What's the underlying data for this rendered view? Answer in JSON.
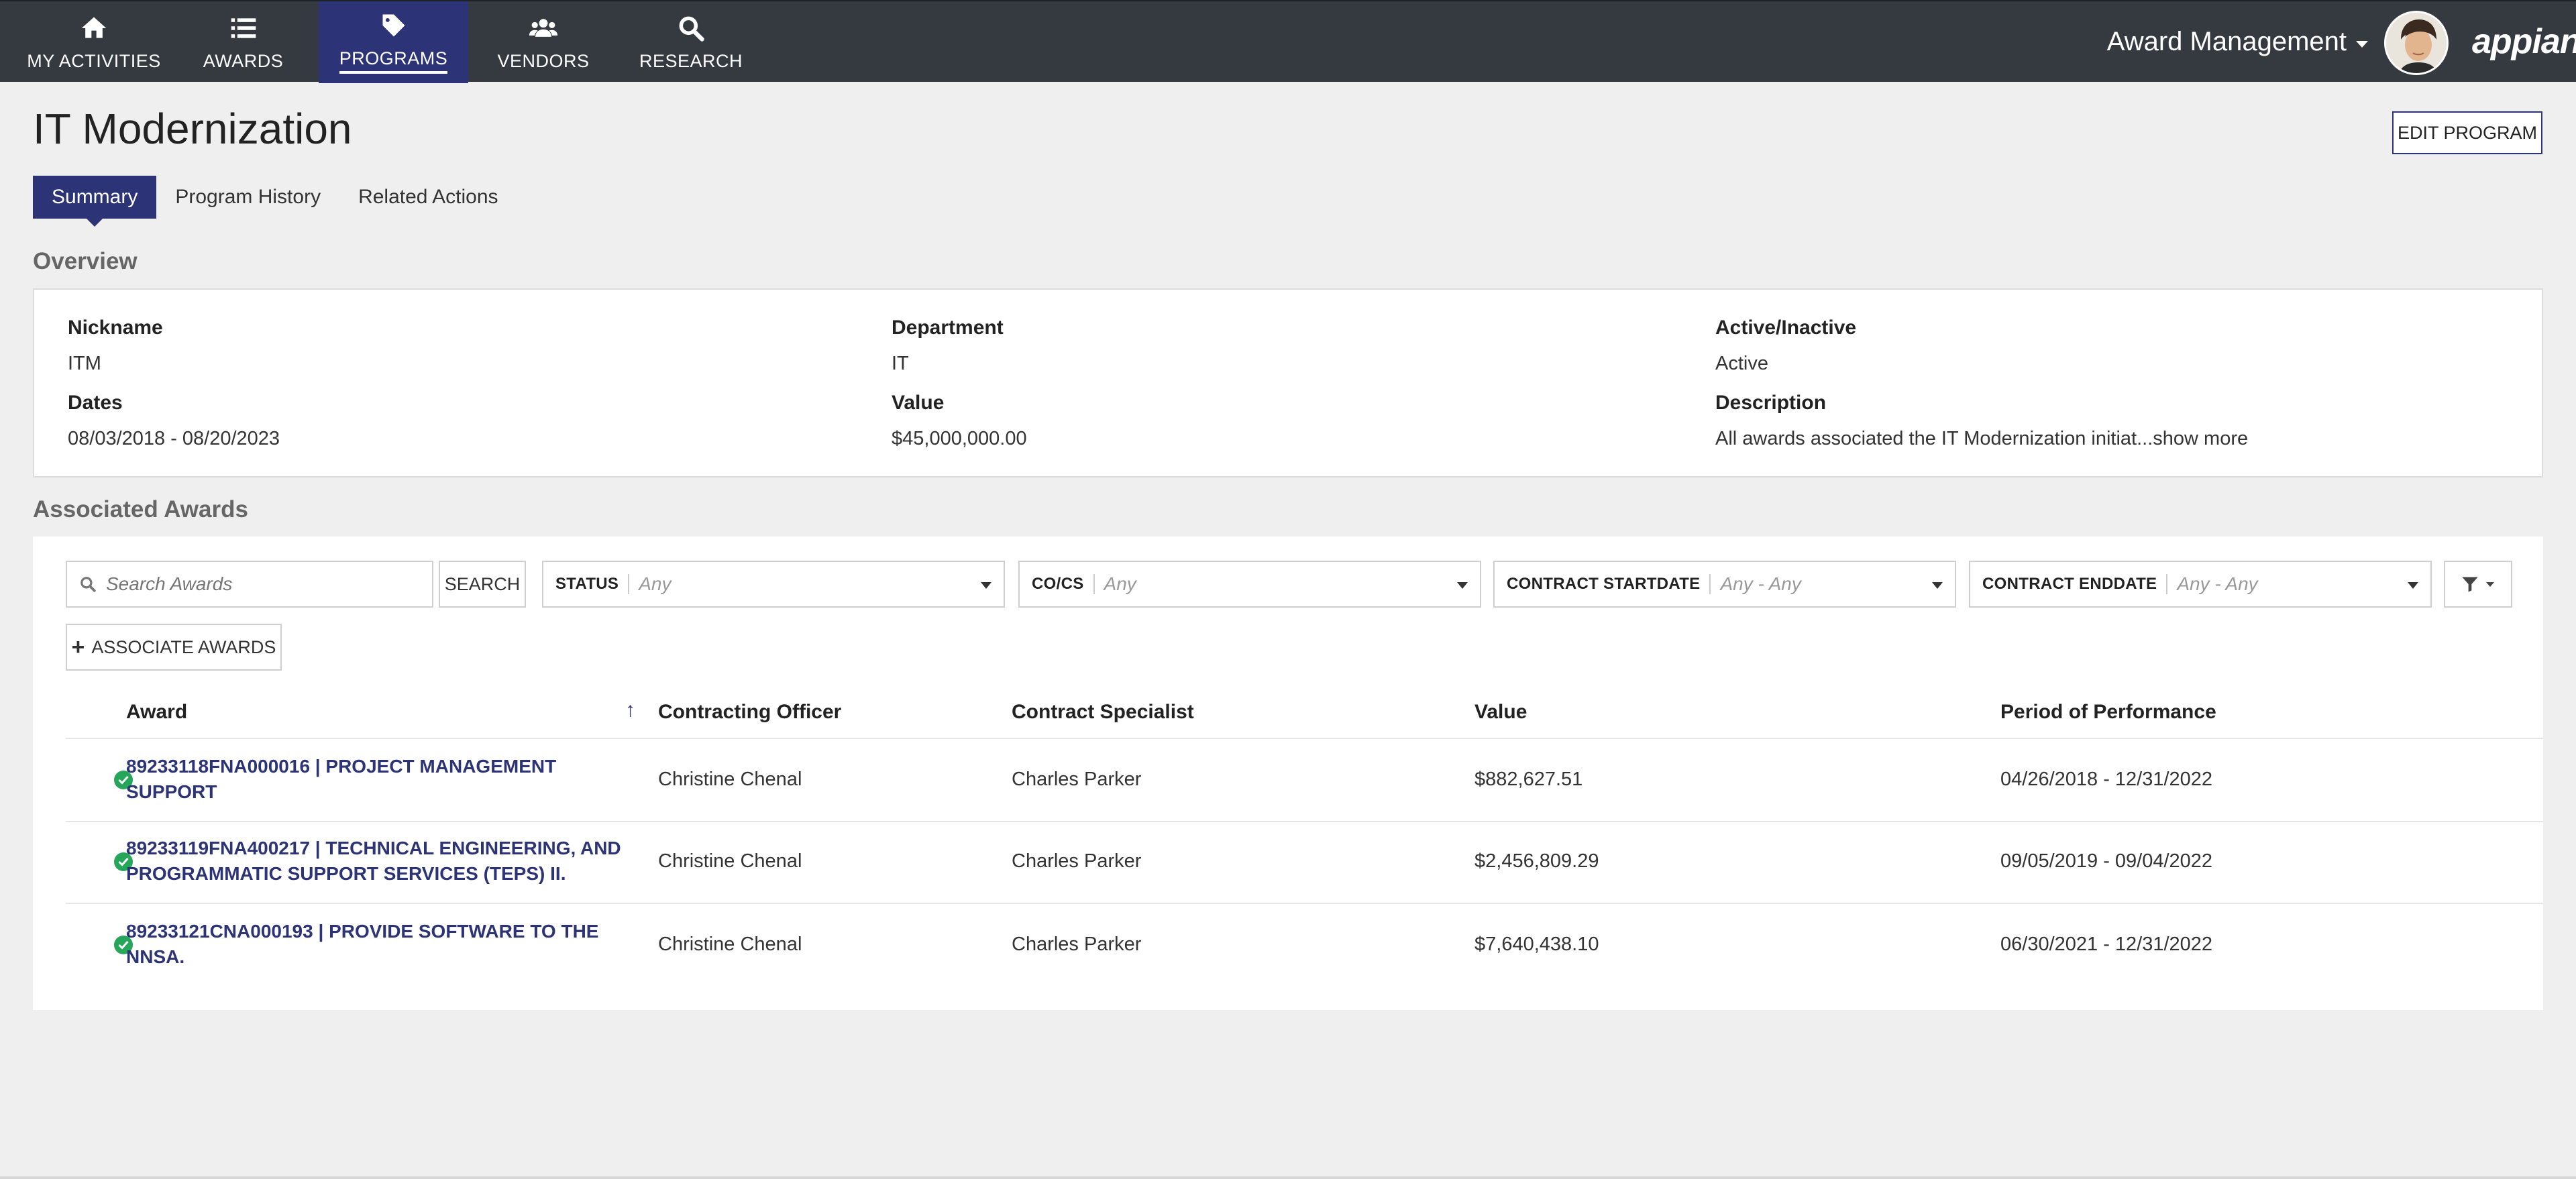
{
  "nav": {
    "items": [
      {
        "label": "MY ACTIVITIES",
        "icon": "home-icon"
      },
      {
        "label": "AWARDS",
        "icon": "list-icon"
      },
      {
        "label": "PROGRAMS",
        "icon": "tag-icon",
        "active": true
      },
      {
        "label": "VENDORS",
        "icon": "people-icon"
      },
      {
        "label": "RESEARCH",
        "icon": "search-icon"
      }
    ],
    "app_name": "Award Management",
    "brand": "appian",
    "bar_color": "#343a40",
    "active_color": "#2c3376"
  },
  "header": {
    "title": "IT Modernization",
    "edit_button": "EDIT PROGRAM",
    "tabs": [
      "Summary",
      "Program History",
      "Related Actions"
    ]
  },
  "overview": {
    "section_title": "Overview",
    "fields": {
      "nickname": {
        "label": "Nickname",
        "value": "ITM"
      },
      "department": {
        "label": "Department",
        "value": "IT"
      },
      "active": {
        "label": "Active/Inactive",
        "value": "Active"
      },
      "dates": {
        "label": "Dates",
        "value": "08/03/2018 - 08/20/2023"
      },
      "value": {
        "label": "Value",
        "value": "$45,000,000.00"
      },
      "description": {
        "label": "Description",
        "value": "All awards associated the IT Modernization initiat...",
        "show_more": "show more"
      }
    }
  },
  "awards": {
    "section_title": "Associated Awards",
    "search": {
      "placeholder": "Search Awards",
      "button": "SEARCH"
    },
    "filters": [
      {
        "label": "STATUS",
        "value": "Any"
      },
      {
        "label": "CO/CS",
        "value": "Any"
      },
      {
        "label": "CONTRACT STARTDATE",
        "value": "Any - Any"
      },
      {
        "label": "CONTRACT ENDDATE",
        "value": "Any - Any"
      }
    ],
    "associate_button": "ASSOCIATE AWARDS",
    "columns": [
      "Award",
      "Contracting Officer",
      "Contract Specialist",
      "Value",
      "Period of Performance"
    ],
    "rows": [
      {
        "award": "89233118FNA000016 | PROJECT MANAGEMENT SUPPORT",
        "officer": "Christine Chenal",
        "specialist": "Charles Parker",
        "value": "$882,627.51",
        "period": "04/26/2018 - 12/31/2022"
      },
      {
        "award": "89233119FNA400217 | TECHNICAL ENGINEERING, AND PROGRAMMATIC SUPPORT SERVICES (TEPS) II.",
        "officer": "Christine Chenal",
        "specialist": "Charles Parker",
        "value": "$2,456,809.29",
        "period": "09/05/2019 - 09/04/2022"
      },
      {
        "award": "89233121CNA000193 | PROVIDE SOFTWARE TO THE NNSA.",
        "officer": "Christine Chenal",
        "specialist": "Charles Parker",
        "value": "$7,640,438.10",
        "period": "06/30/2021 - 12/31/2022"
      }
    ],
    "status_color": "#26a65b"
  }
}
